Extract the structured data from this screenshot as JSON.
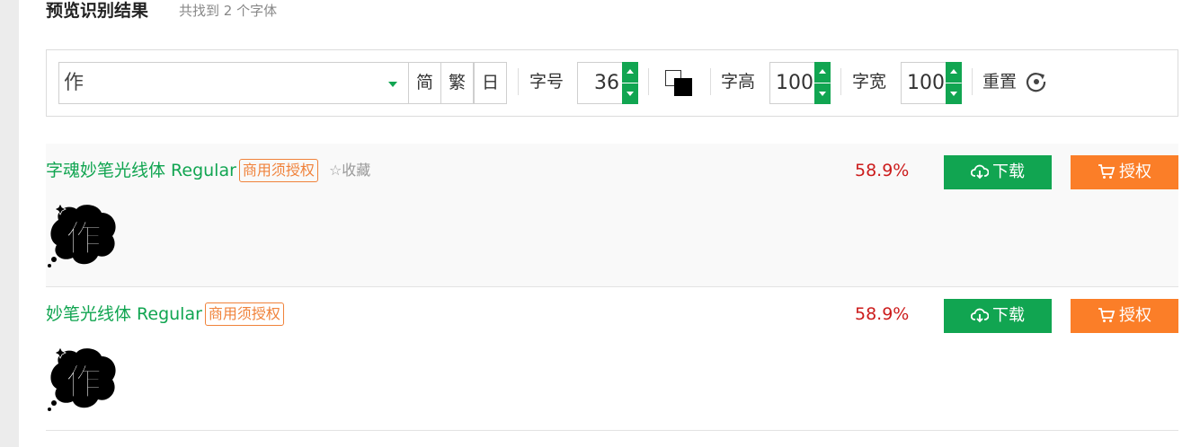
{
  "header": {
    "title": "预览识别结果",
    "count_text": "共找到 2 个字体"
  },
  "toolbar": {
    "char_value": "作",
    "script_buttons": [
      "简",
      "繁",
      "日"
    ],
    "size_label": "字号",
    "size_value": "36",
    "height_label": "字高",
    "height_value": "100",
    "width_label": "字宽",
    "width_value": "100",
    "reset_label": "重置",
    "colors": {
      "foreground": "#000000",
      "background": "#ffffff"
    }
  },
  "results": [
    {
      "name": "字魂妙笔光线体 Regular",
      "license": "商用须授权",
      "favorite": "☆收藏",
      "similarity": "58.9%",
      "download_label": "下载",
      "authorize_label": "授权",
      "preview_char": "作"
    },
    {
      "name": "妙笔光线体 Regular",
      "license": "商用须授权",
      "similarity": "58.9%",
      "download_label": "下载",
      "authorize_label": "授权",
      "preview_char": "作"
    }
  ],
  "colors": {
    "accent_green": "#11a551",
    "accent_orange": "#fb7e28",
    "similarity_red": "#cc1c1c"
  }
}
